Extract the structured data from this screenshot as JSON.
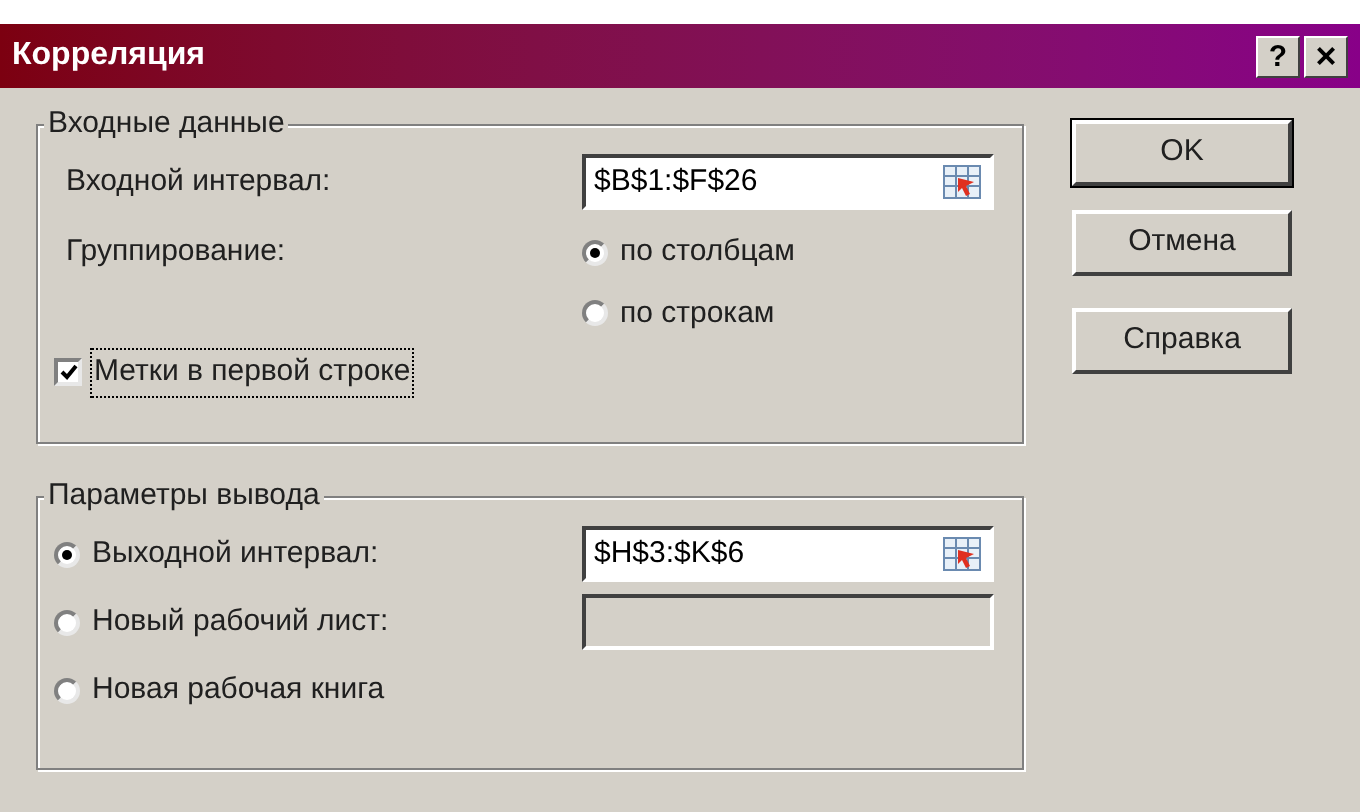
{
  "window": {
    "title": "Корреляция",
    "help_button": "?",
    "close_button": "×"
  },
  "input_group": {
    "title": "Входные данные",
    "range_label": "Входной интервал:",
    "range_value": "$B$1:$F$26",
    "grouping_label": "Группирование:",
    "grouping_options": [
      {
        "label": "по столбцам",
        "selected": true
      },
      {
        "label": "по строкам",
        "selected": false
      }
    ],
    "labels_checkbox": {
      "label": "Метки в первой строке",
      "checked": true,
      "focused": true
    }
  },
  "output_group": {
    "title": "Параметры вывода",
    "options": [
      {
        "label": "Выходной интервал:",
        "selected": true,
        "value": "$H$3:$K$6",
        "kind": "range"
      },
      {
        "label": "Новый рабочий лист:",
        "selected": false,
        "kind": "text"
      },
      {
        "label": "Новая рабочая книга",
        "selected": false,
        "kind": "none"
      }
    ]
  },
  "buttons": [
    {
      "label": "OK",
      "default": true
    },
    {
      "label": "Отмена",
      "default": false
    },
    {
      "label": "Справка",
      "default": false
    }
  ]
}
